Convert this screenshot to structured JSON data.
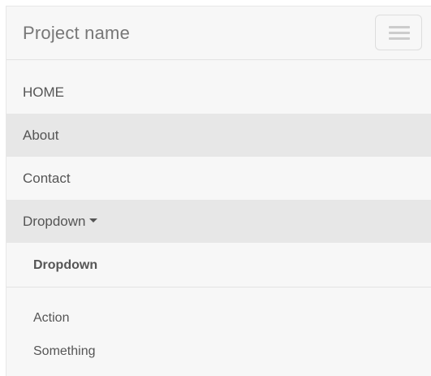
{
  "navbar": {
    "brand": "Project name",
    "toggle_icon": "hamburger-menu-icon"
  },
  "nav": {
    "items": [
      {
        "label": "HOME",
        "active": false
      },
      {
        "label": "About",
        "active": true
      },
      {
        "label": "Contact",
        "active": false
      },
      {
        "label": "Dropdown",
        "active": true,
        "has_caret": true
      }
    ]
  },
  "dropdown": {
    "header": "Dropdown",
    "items": [
      {
        "label": "Action"
      },
      {
        "label": "Something"
      }
    ]
  },
  "colors": {
    "navbar_background": "#f7f7f7",
    "active_item_background": "#e7e7e7",
    "text": "#555555",
    "brand_text": "#777777"
  }
}
